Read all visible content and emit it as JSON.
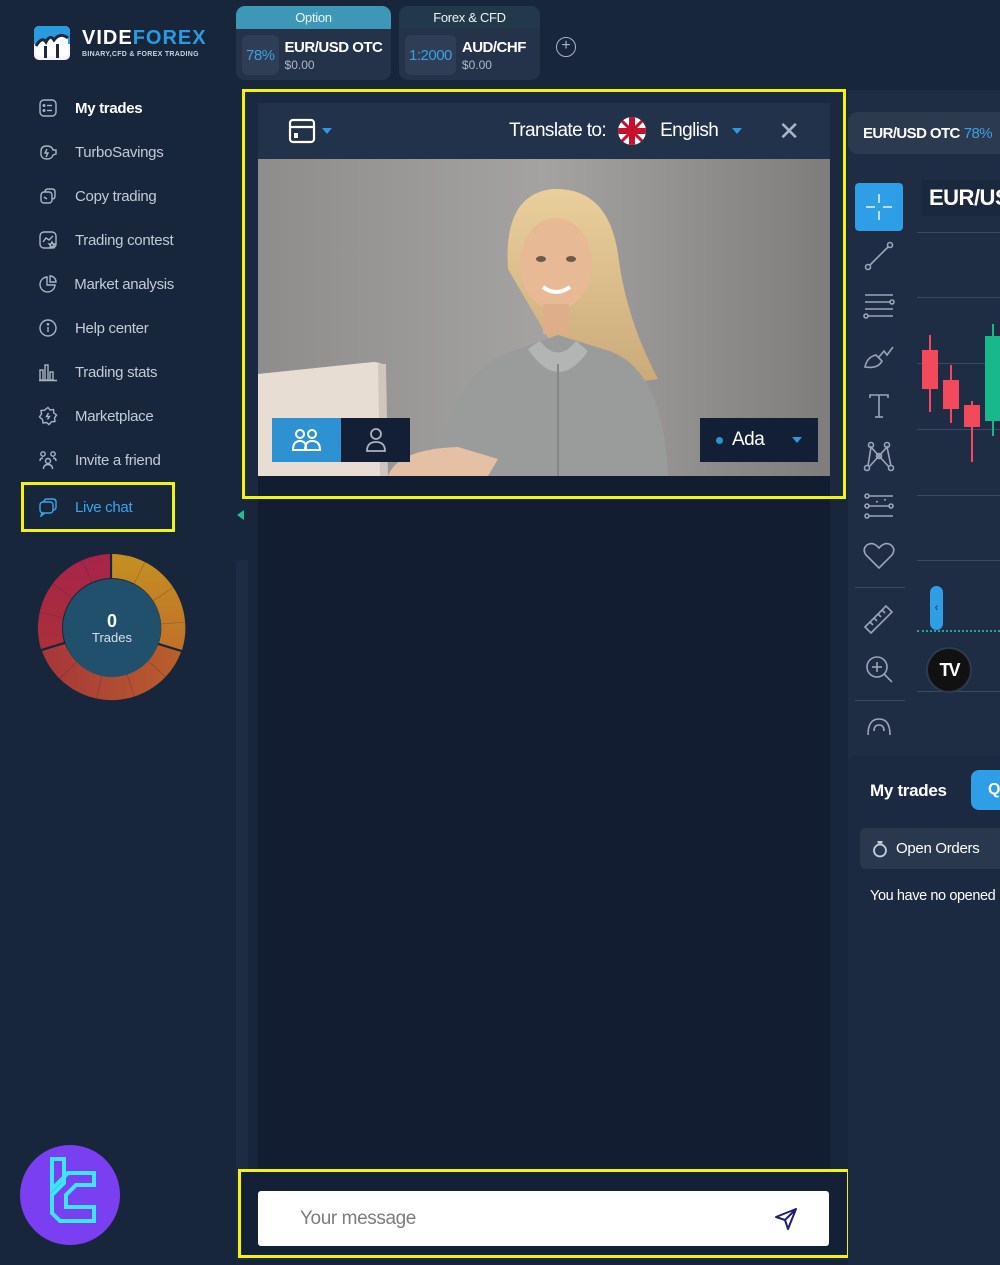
{
  "app": {
    "brand_word_1": "VIDE",
    "brand_word_2": "FOREX",
    "brand_tagline": "BINARY,CFD & FOREX TRADING"
  },
  "asset_tabs": [
    {
      "category": "Option",
      "chip": "78%",
      "pair": "EUR/USD OTC",
      "amount": "$0.00"
    },
    {
      "category": "Forex & CFD",
      "chip": "1:2000",
      "pair": "AUD/CHF",
      "amount": "$0.00"
    }
  ],
  "add_tab_label": "+",
  "sidebar": {
    "items": [
      {
        "label": "My trades",
        "icon": "list-icon"
      },
      {
        "label": "TurboSavings",
        "icon": "piggy-bank-icon"
      },
      {
        "label": "Copy trading",
        "icon": "copy-trading-icon"
      },
      {
        "label": "Trading contest",
        "icon": "contest-icon"
      },
      {
        "label": "Market analysis",
        "icon": "pie-chart-icon"
      },
      {
        "label": "Help center",
        "icon": "info-icon"
      },
      {
        "label": "Trading stats",
        "icon": "bar-chart-icon"
      },
      {
        "label": "Marketplace",
        "icon": "badge-icon"
      },
      {
        "label": "Invite a friend",
        "icon": "users-icon"
      },
      {
        "label": "Live chat",
        "icon": "chat-icon",
        "active": true
      }
    ]
  },
  "trades_donut": {
    "value": "0",
    "label": "Trades",
    "colors": {
      "loss": "#a42a45",
      "win": "#c8892a"
    }
  },
  "chat": {
    "translate_label": "Translate to:",
    "language": "English",
    "agent_name": "Ada",
    "message_placeholder": "Your message",
    "close_icon": "close-icon",
    "send_icon": "send-icon"
  },
  "chart": {
    "pair_pill": "EUR/USD OTC",
    "pair_pill_pct": "78%",
    "title": "EUR/US",
    "tv_logo": "TV",
    "tools": [
      "crosshair-icon",
      "trend-line-icon",
      "fib-retracement-icon",
      "brush-icon",
      "text-icon",
      "pattern-icon",
      "forecast-icon",
      "favorite-heart-icon",
      "ruler-icon",
      "zoom-in-icon",
      "magnet-icon"
    ],
    "candles": [
      {
        "type": "bear"
      },
      {
        "type": "bear"
      },
      {
        "type": "bear"
      },
      {
        "type": "bull"
      }
    ],
    "colors": {
      "bull": "#17b98a",
      "bear": "#f2495c"
    }
  },
  "trades_panel": {
    "title": "My trades",
    "q_button": "Q",
    "open_orders": "Open Orders",
    "empty_text": "You have no opened"
  },
  "colors": {
    "accent": "#2e9fe6",
    "highlight": "#f4f40a",
    "background": "#18263b"
  }
}
